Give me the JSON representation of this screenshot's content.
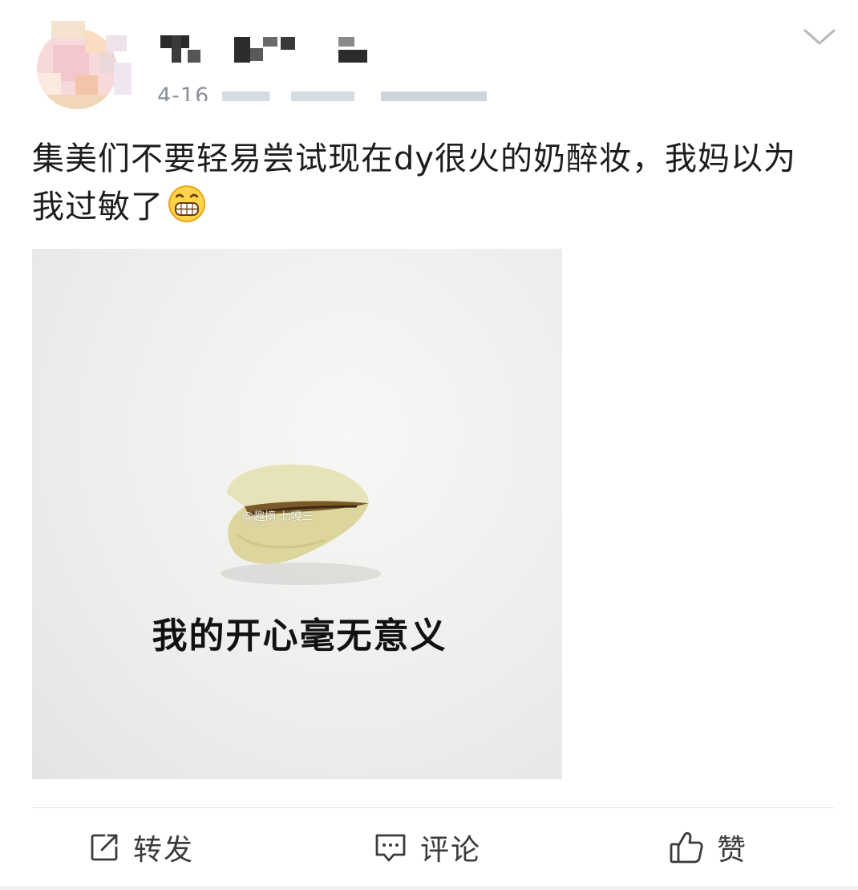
{
  "post": {
    "date": "4-16",
    "text": "集美们不要轻易尝试现在dy很火的奶醉妆，我妈以为我过敏了",
    "emoji_icon": "grinning-face-emoji"
  },
  "meme": {
    "caption": "我的开心毫无意义",
    "watermark": "@趣摘 七嘎三"
  },
  "actions": {
    "repost_label": "转发",
    "comment_label": "评论",
    "like_label": "赞"
  },
  "colors": {
    "meta_text": "#8a8f99",
    "body_text": "#1d1d1d",
    "icon_stroke": "#3b3b3b"
  }
}
